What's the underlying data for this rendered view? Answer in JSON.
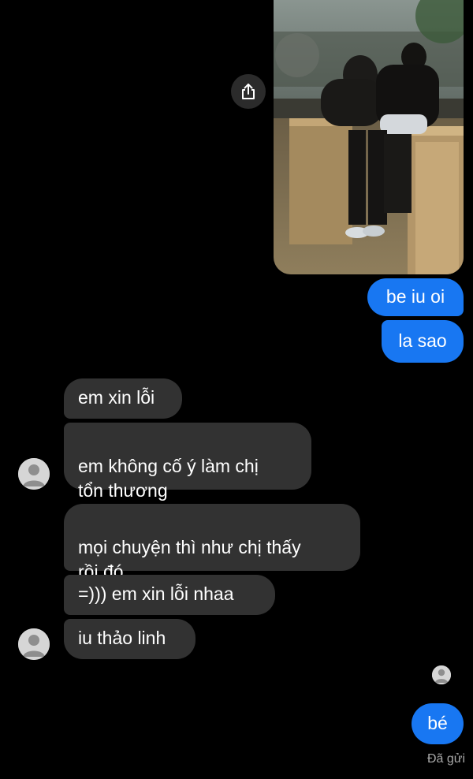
{
  "conversation": {
    "shared_photo": {
      "alt": "",
      "share_icon": "share-icon"
    },
    "outgoing_top": [
      {
        "text": "be iu oi"
      },
      {
        "text": "la sao"
      }
    ],
    "incoming_group_1": [
      {
        "text": "em xin lỗi"
      },
      {
        "text": "em không cố ý làm chị\ntổn thương"
      }
    ],
    "incoming_group_2": [
      {
        "text": "mọi chuyện thì như chị thấy\nrồi đó"
      },
      {
        "text": "=))) em xin lỗi nhaa"
      },
      {
        "text": "iu thảo linh"
      }
    ],
    "outgoing_bottom": [
      {
        "text": "bé"
      }
    ],
    "sent_status": "Đã gửi"
  },
  "colors": {
    "background": "#000000",
    "outgoing_bubble": "#1877f2",
    "incoming_bubble": "#323232",
    "status_text": "#a8a8a8"
  }
}
